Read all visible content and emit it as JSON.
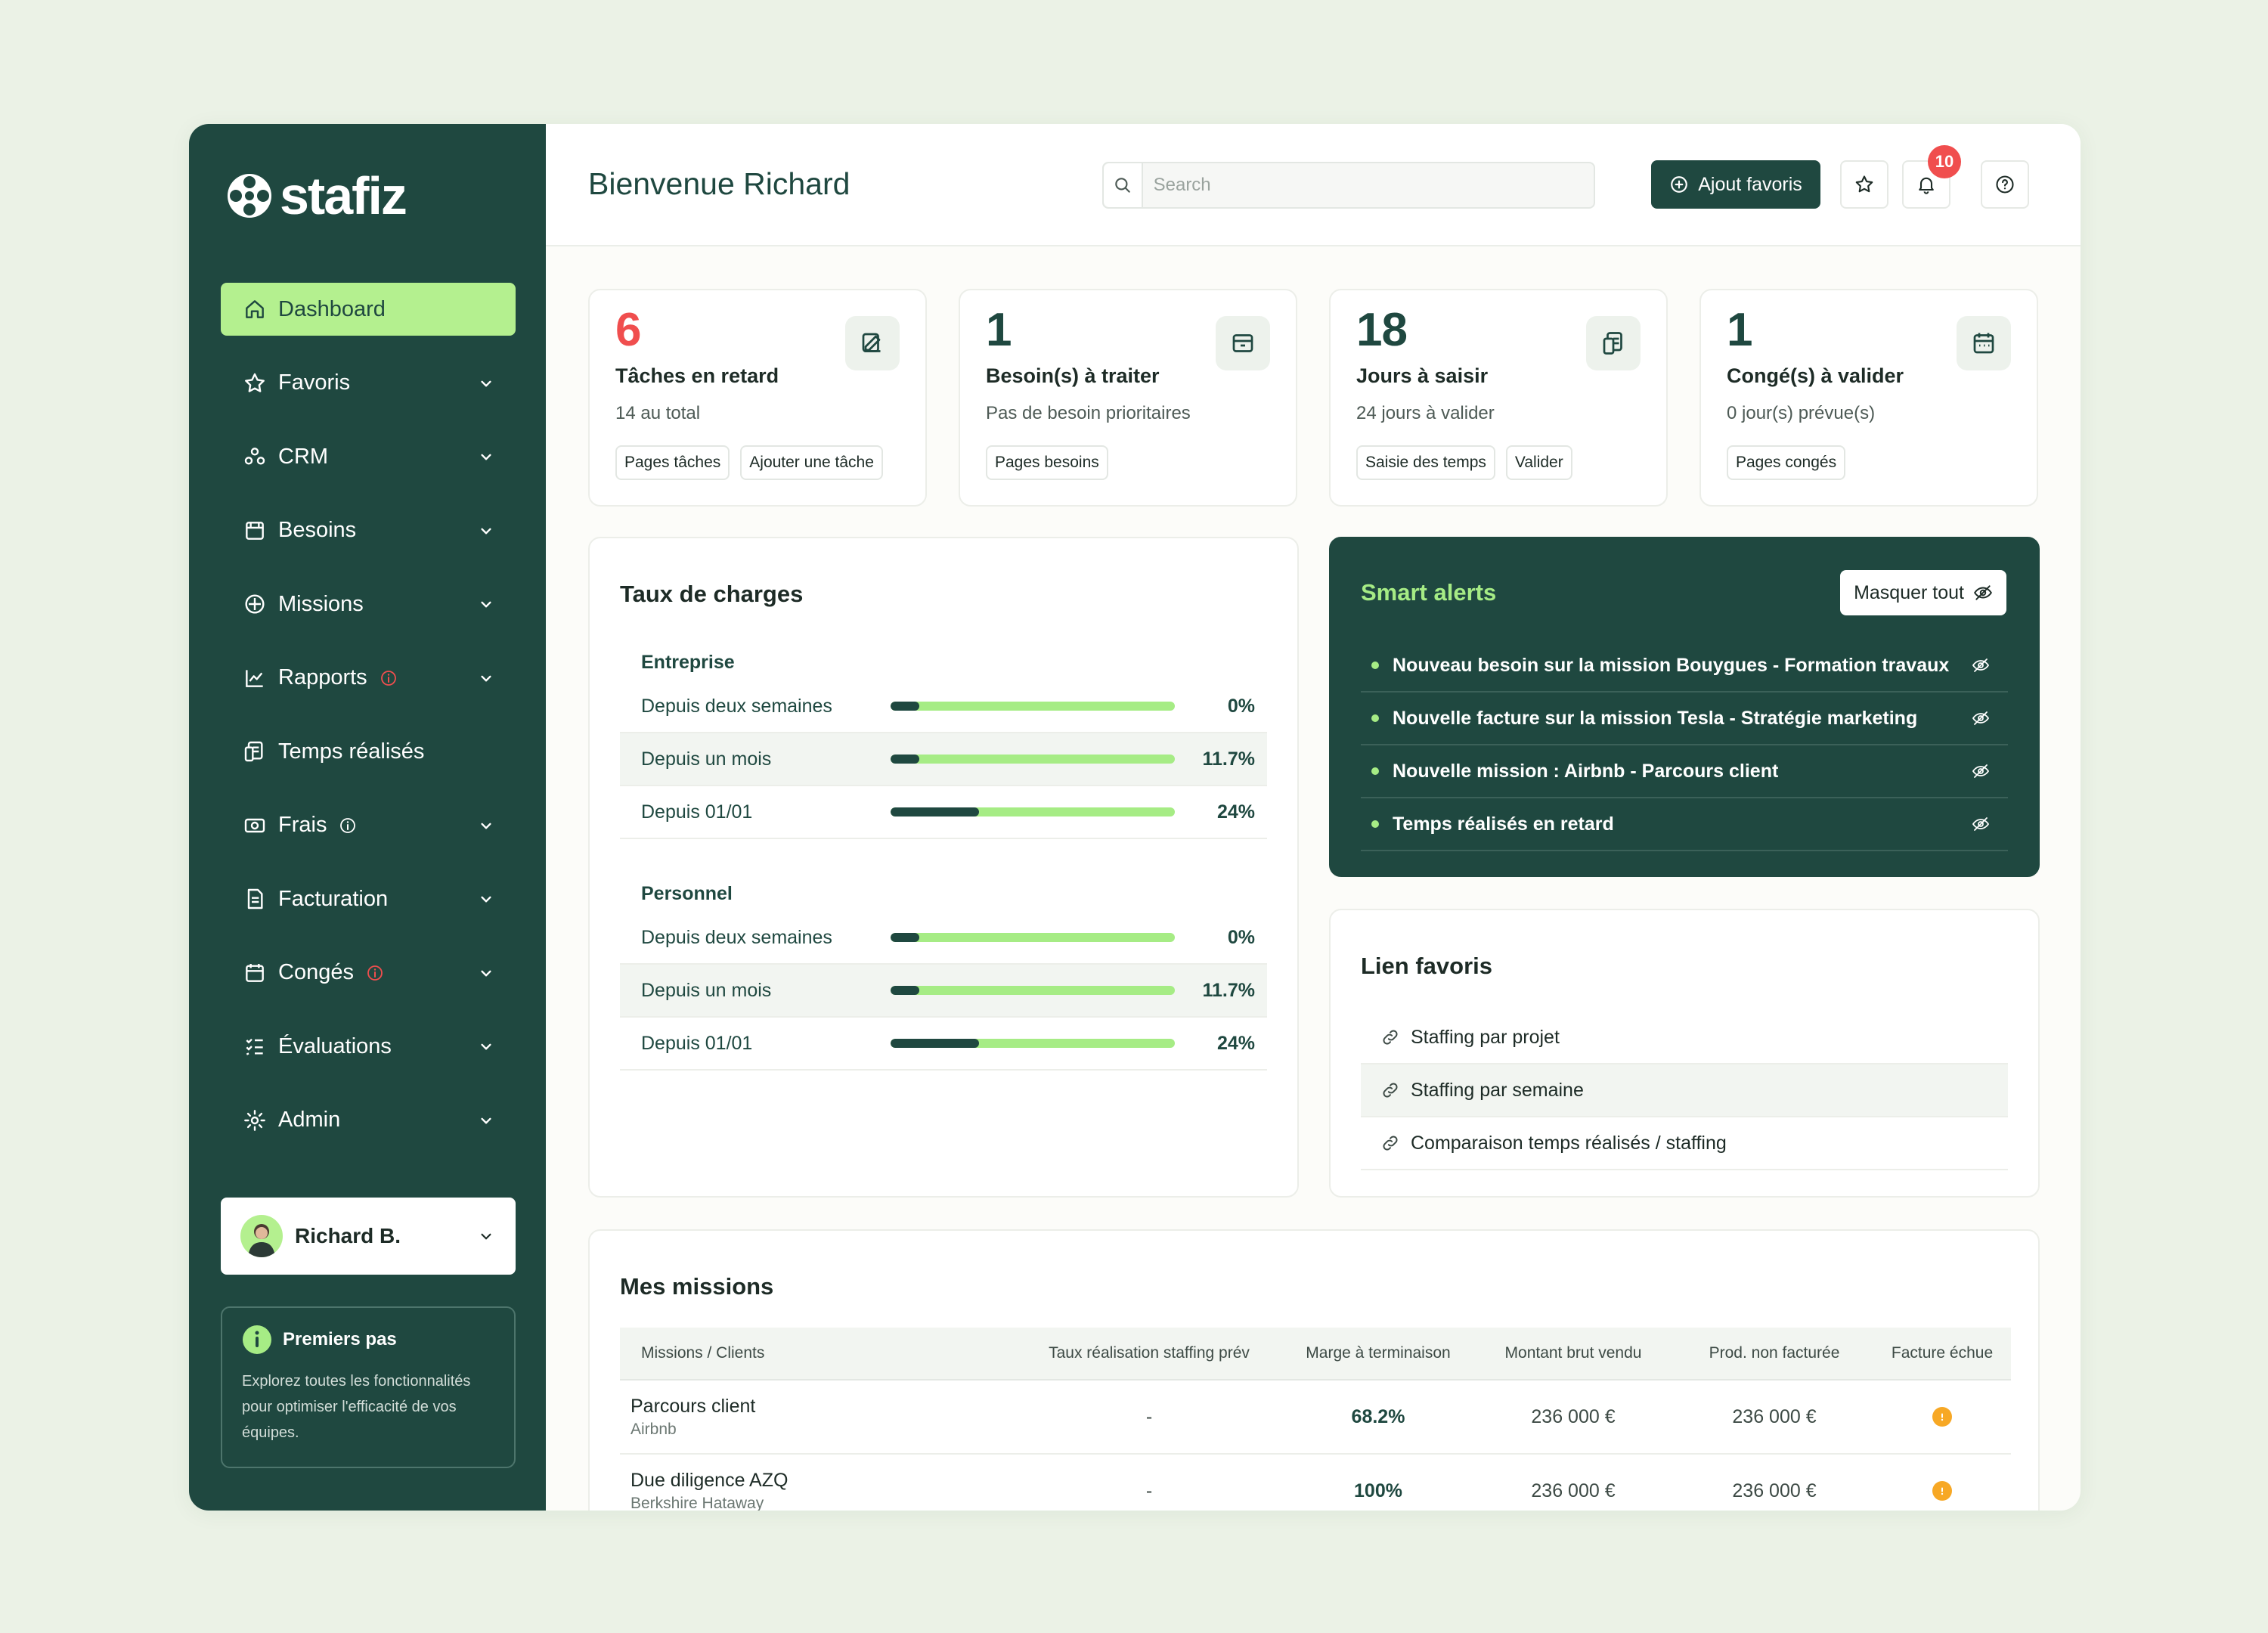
{
  "brand": {
    "name": "stafiz"
  },
  "sidebar": {
    "items": [
      {
        "label": "Dashboard",
        "icon": "home-icon",
        "active": true,
        "chevron": false,
        "warning": false
      },
      {
        "label": "Favoris",
        "icon": "star-icon",
        "chevron": true,
        "warning": false
      },
      {
        "label": "CRM",
        "icon": "people-icon",
        "chevron": true,
        "warning": false
      },
      {
        "label": "Besoins",
        "icon": "folder-icon",
        "chevron": true,
        "warning": false
      },
      {
        "label": "Missions",
        "icon": "compass-icon",
        "chevron": true,
        "warning": false
      },
      {
        "label": "Rapports",
        "icon": "chart-icon",
        "chevron": true,
        "warning": true
      },
      {
        "label": "Temps réalisés",
        "icon": "clock-receipt-icon",
        "chevron": false,
        "warning": false
      },
      {
        "label": "Frais",
        "icon": "money-icon",
        "chevron": true,
        "warning": true
      },
      {
        "label": "Facturation",
        "icon": "invoice-icon",
        "chevron": true,
        "warning": false
      },
      {
        "label": "Congés",
        "icon": "calendar-icon",
        "chevron": true,
        "warning": true
      },
      {
        "label": "Évaluations",
        "icon": "checklist-icon",
        "chevron": true,
        "warning": false
      },
      {
        "label": "Admin",
        "icon": "gear-icon",
        "chevron": true,
        "warning": false
      }
    ],
    "user": {
      "name": "Richard B."
    },
    "first_steps": {
      "title": "Premiers pas",
      "text": "Explorez toutes les fonctionnalités pour optimiser l'efficacité de vos équipes."
    }
  },
  "header": {
    "title": "Bienvenue Richard",
    "search_placeholder": "Search",
    "add_favorite_label": "Ajout favoris",
    "notifications_count": "10"
  },
  "stats": [
    {
      "value": "6",
      "label": "Tâches en retard",
      "sub": "14 au total",
      "chips": [
        "Pages tâches",
        "Ajouter une tâche"
      ],
      "highlight": true
    },
    {
      "value": "1",
      "label": "Besoin(s) à traiter",
      "sub": "Pas de besoin prioritaires",
      "chips": [
        "Pages besoins"
      ],
      "highlight": false
    },
    {
      "value": "18",
      "label": "Jours à saisir",
      "sub": "24 jours à valider",
      "chips": [
        "Saisie des temps",
        "Valider"
      ],
      "highlight": false
    },
    {
      "value": "1",
      "label": "Congé(s) à valider",
      "sub": "0 jour(s) prévue(s)",
      "chips": [
        "Pages congés"
      ],
      "highlight": false
    }
  ],
  "charges": {
    "title": "Taux de charges",
    "groups": [
      {
        "title": "Entreprise",
        "rows": [
          {
            "label": "Depuis deux semaines",
            "value": "0%",
            "fraction": 0.1
          },
          {
            "label": "Depuis un mois",
            "value": "11.7%",
            "fraction": 0.1
          },
          {
            "label": "Depuis 01/01",
            "value": "24%",
            "fraction": 0.31
          }
        ]
      },
      {
        "title": "Personnel",
        "rows": [
          {
            "label": "Depuis deux semaines",
            "value": "0%",
            "fraction": 0.1
          },
          {
            "label": "Depuis un mois",
            "value": "11.7%",
            "fraction": 0.1
          },
          {
            "label": "Depuis 01/01",
            "value": "24%",
            "fraction": 0.31
          }
        ]
      }
    ]
  },
  "alerts": {
    "title": "Smart alerts",
    "mask_label": "Masquer tout",
    "items": [
      "Nouveau besoin sur la mission Bouygues - Formation travaux",
      "Nouvelle facture sur la mission Tesla - Stratégie marketing",
      "Nouvelle mission : Airbnb - Parcours client",
      "Temps réalisés en retard"
    ]
  },
  "links": {
    "title": "Lien favoris",
    "items": [
      "Staffing par projet",
      "Staffing par semaine",
      "Comparaison temps réalisés / staffing"
    ]
  },
  "missions": {
    "title": "Mes missions",
    "columns": [
      "Missions / Clients",
      "Taux réalisation staffing prév",
      "Marge à terminaison",
      "Montant brut vendu",
      "Prod. non facturée",
      "Facture échue"
    ],
    "rows": [
      {
        "name": "Parcours client",
        "client": "Airbnb",
        "staffing": "-",
        "marge": "68.2%",
        "montant": "236 000 €",
        "prod": "236 000 €"
      },
      {
        "name": "Due diligence AZQ",
        "client": "Berkshire Hataway",
        "staffing": "-",
        "marge": "100%",
        "montant": "236 000 €",
        "prod": "236 000 €"
      }
    ]
  },
  "colors": {
    "sidebar": "#1f4840",
    "accent": "#b4f08f",
    "danger": "#f04e4e",
    "warning": "#f7a825"
  }
}
